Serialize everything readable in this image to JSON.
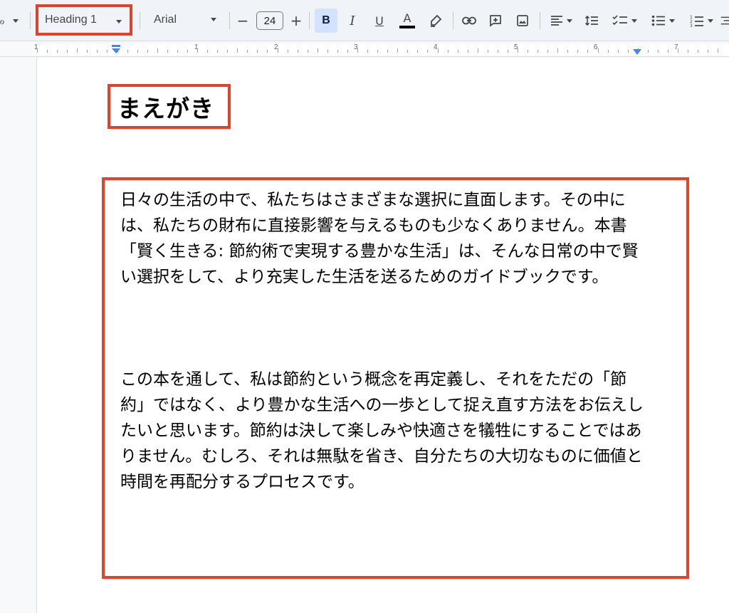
{
  "toolbar": {
    "paragraph_style": "Heading 1",
    "font_family": "Arial",
    "font_size": "24",
    "bold_label": "B",
    "italic_label": "I",
    "underline_label": "U",
    "text_color_label": "A",
    "minus_label": "−",
    "plus_label": "+"
  },
  "ruler": {
    "labels": [
      "1",
      "1",
      "2",
      "3",
      "4",
      "5",
      "6",
      "7"
    ]
  },
  "document": {
    "heading": "まえがき",
    "paragraphs": [
      "日々の生活の中で、私たちはさまざまな選択に直面します。その中には、私たちの財布に直接影響を与えるものも少なくありません。本書「賢く生きる: 節約術で実現する豊かな生活」は、そんな日常の中で賢い選択をして、より充実した生活を送るためのガイドブックです。",
      "この本を通して、私は節約という概念を再定義し、それをただの「節約」ではなく、より豊かな生活への一歩として捉え直す方法をお伝えしたいと思います。節約は決して楽しみや快適さを犠牲にすることではありません。むしろ、それは無駄を省き、自分たちの大切なものに価値と時間を再配分するプロセスです。"
    ]
  },
  "colors": {
    "highlight_border": "#e2412a",
    "active_button_bg": "#d3e3fd",
    "toolbar_bg": "#f0f4f9"
  }
}
